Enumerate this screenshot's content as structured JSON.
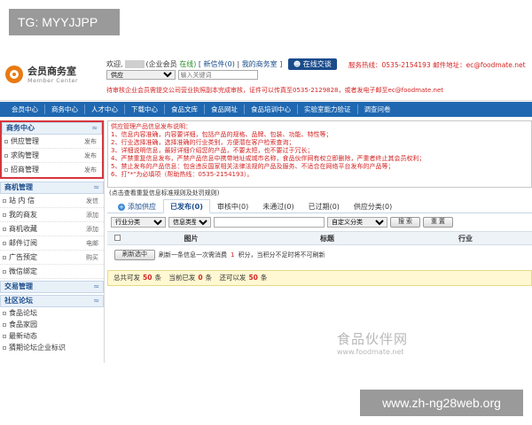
{
  "overlay": {
    "tg_label": "TG: MYYJJPP",
    "site_url": "www.zh-ng28web.org"
  },
  "header": {
    "logo_title": "会员商务室",
    "logo_sub": "Member Center",
    "welcome_prefix": "欢迎,",
    "member_type": "(企业会员",
    "online_status": "在线)",
    "inbox_link": "[ 新信件(0)",
    "sep": "|",
    "my_office_link": "我的商务室 ]",
    "online_chat": "在线交谈",
    "hotline": "服务热线：0535-2154193 邮件地址：ec@foodmate.net",
    "search_select": "供应",
    "search_placeholder": "输入关键词",
    "notice": "待审核企业会员需提交公司营业执照副本完成审核，证件可以传真至0535-2129828，或者发电子邮至ec@foodmate.net"
  },
  "nav": {
    "items": [
      "会员中心",
      "商务中心",
      "人才中心",
      "下载中心",
      "食品文库",
      "食品网址",
      "食品培训中心",
      "实验室能力验证",
      "调查问卷"
    ]
  },
  "sidebar": {
    "business_center": "商务中心",
    "business_items": [
      {
        "label": "供应管理",
        "action": "发布"
      },
      {
        "label": "求购管理",
        "action": "发布"
      },
      {
        "label": "招商管理",
        "action": "发布"
      }
    ],
    "biz_manage": "商机管理",
    "biz_manage_items": [
      {
        "label": "站 内 信",
        "action": "发信"
      },
      {
        "label": "我的商友",
        "action": "添加"
      },
      {
        "label": "商机收藏",
        "action": "添加"
      },
      {
        "label": "邮件订阅",
        "action": "电邮"
      },
      {
        "label": "广告预定",
        "action": "购买"
      },
      {
        "label": "微信绑定",
        "action": ""
      }
    ],
    "trade_manage": "交易管理",
    "forum": "社区论坛",
    "forum_items": [
      "食品论坛",
      "食品家园",
      "最新动态",
      "猜期论坛企业标识"
    ]
  },
  "main": {
    "rules_title": "供应管理产品信息发布说明：",
    "rules": [
      "1、信息内容准确，内容要详细，包括产品的规格、品牌、包装、功能、特性等；",
      "2、行业选择准确，选择准确的行业类别，方便潜在客户检索查询；",
      "3、详细说明信息，最好详细介绍您的产品，不要太短，也不要过于冗长；",
      "4、严禁重复信息发布，严禁产品信息中携带地址或城市名称，食品伙伴网有权立即删除，严重者终止其会员权利；",
      "5、禁止发布的产品信息：包含违反国家相关法律法规的产品及服务、不适合在网络平台发布的产品等；",
      "6、打\"*\"为必填项（帮助热线：0535-2154193）。"
    ],
    "rules_link": "(点击查看重复信息标准规则及处罚规则)",
    "tabs": [
      {
        "label": "添加供应",
        "kind": "add"
      },
      {
        "label": "已发布(0)",
        "kind": "active"
      },
      {
        "label": "审核中(0)",
        "kind": "normal"
      },
      {
        "label": "未通过(0)",
        "kind": "normal"
      },
      {
        "label": "已过期(0)",
        "kind": "normal"
      },
      {
        "label": "供应分类(0)",
        "kind": "normal"
      }
    ],
    "filter": {
      "category": "行业分类",
      "info_type": "信息类型",
      "custom_category": "自定义分类",
      "search_btn": "搜 索",
      "reset_btn": "重 置"
    },
    "table_headers": {
      "image": "图片",
      "title": "标题",
      "trade": "行业"
    },
    "refresh": {
      "btn": "刷新选中",
      "text_prefix": "刷新一条信息一次需消费",
      "cost": "1",
      "text_suffix": "积分，当积分不足时将不可刷新"
    },
    "quota": {
      "total_label": "总共可发",
      "total": "50",
      "unit1": "条",
      "used_label": "当前已发",
      "used": "0",
      "unit2": "条",
      "left_label": "还可以发",
      "left": "50",
      "unit3": "条"
    }
  },
  "watermark": {
    "cn": "食品伙伴网",
    "en": "www.foodmate.net"
  }
}
